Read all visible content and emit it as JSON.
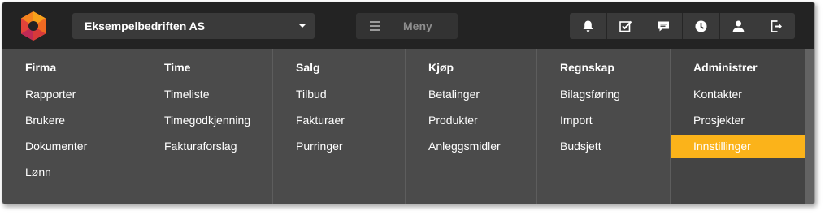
{
  "header": {
    "company": "Eksempelbedriften AS",
    "menu_label": "Meny",
    "icons": [
      "bell-icon",
      "checkbox-icon",
      "chat-icon",
      "clock-icon",
      "user-icon",
      "logout-icon"
    ]
  },
  "menu": {
    "columns": [
      {
        "title": "Firma",
        "items": [
          "Rapporter",
          "Brukere",
          "Dokumenter",
          "Lønn"
        ]
      },
      {
        "title": "Time",
        "items": [
          "Timeliste",
          "Timegodkjenning",
          "Fakturaforslag"
        ]
      },
      {
        "title": "Salg",
        "items": [
          "Tilbud",
          "Fakturaer",
          "Purringer"
        ]
      },
      {
        "title": "Kjøp",
        "items": [
          "Betalinger",
          "Produkter",
          "Anleggsmidler"
        ]
      },
      {
        "title": "Regnskap",
        "items": [
          "Bilagsføring",
          "Import",
          "Budsjett"
        ]
      },
      {
        "title": "Administrer",
        "items": [
          "Kontakter",
          "Prosjekter",
          "Innstillinger"
        ]
      }
    ],
    "active_item": "Innstillinger"
  },
  "colors": {
    "topbar": "#232323",
    "menu_bg": "#4b4b4b",
    "accent": "#fbb31a"
  }
}
